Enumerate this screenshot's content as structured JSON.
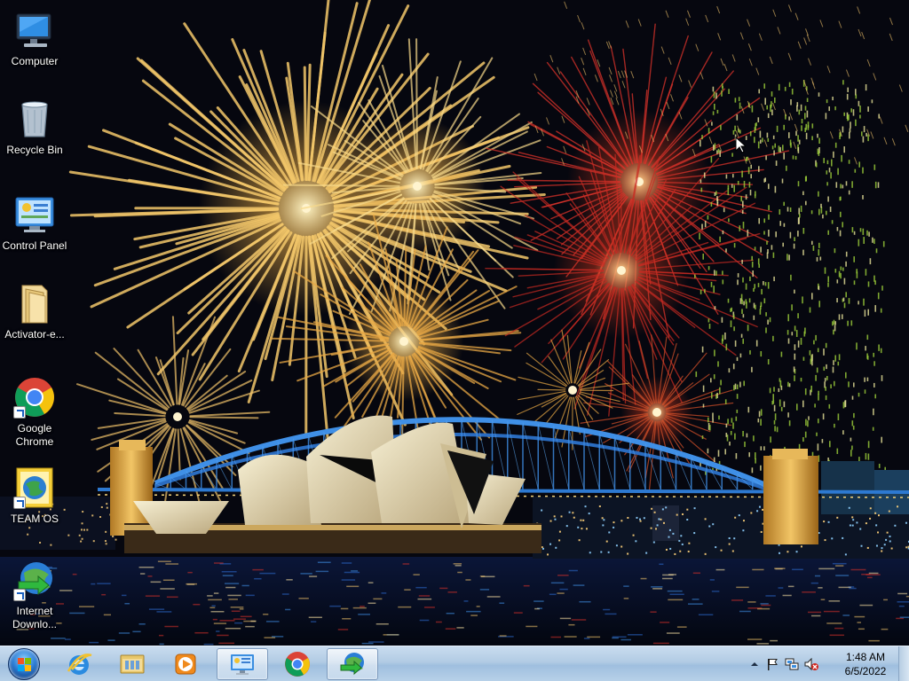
{
  "desktop": {
    "icons": [
      {
        "label": "Computer",
        "icon": "computer-icon"
      },
      {
        "label": "Recycle Bin",
        "icon": "recycle-bin-icon"
      },
      {
        "label": "Control Panel",
        "icon": "control-panel-icon"
      },
      {
        "label": "Activator-e...",
        "icon": "folder-icon"
      },
      {
        "label": "Google Chrome",
        "icon": "chrome-icon"
      },
      {
        "label": "TEAM OS",
        "icon": "team-os-icon"
      },
      {
        "label": "Internet Downlo...",
        "icon": "idm-icon"
      }
    ]
  },
  "taskbar": {
    "start": {
      "icon": "windows-orb-icon"
    },
    "pinned": [
      {
        "name": "Internet Explorer",
        "icon": "ie-icon",
        "active": false
      },
      {
        "name": "Windows Explorer",
        "icon": "explorer-icon",
        "active": false
      },
      {
        "name": "Windows Media Player",
        "icon": "media-player-icon",
        "active": false
      },
      {
        "name": "Control Panel",
        "icon": "control-panel-icon",
        "active": true
      },
      {
        "name": "Google Chrome",
        "icon": "chrome-icon",
        "active": false
      },
      {
        "name": "Internet Download Manager",
        "icon": "idm-icon",
        "active": true
      }
    ],
    "tray": {
      "icons": [
        "show-hidden-icons-arrow",
        "action-center-flag-icon",
        "network-icon",
        "volume-muted-icon"
      ],
      "time": "1:48 AM",
      "date": "6/5/2022"
    }
  },
  "colors": {
    "taskbar_top": "#c9dcef",
    "taskbar_bottom": "#9fbfdf",
    "firework_gold": "#f3c76a",
    "firework_red": "#d9322a",
    "firework_green": "#9ccf3a",
    "bridge_blue": "#3f8fe6"
  }
}
